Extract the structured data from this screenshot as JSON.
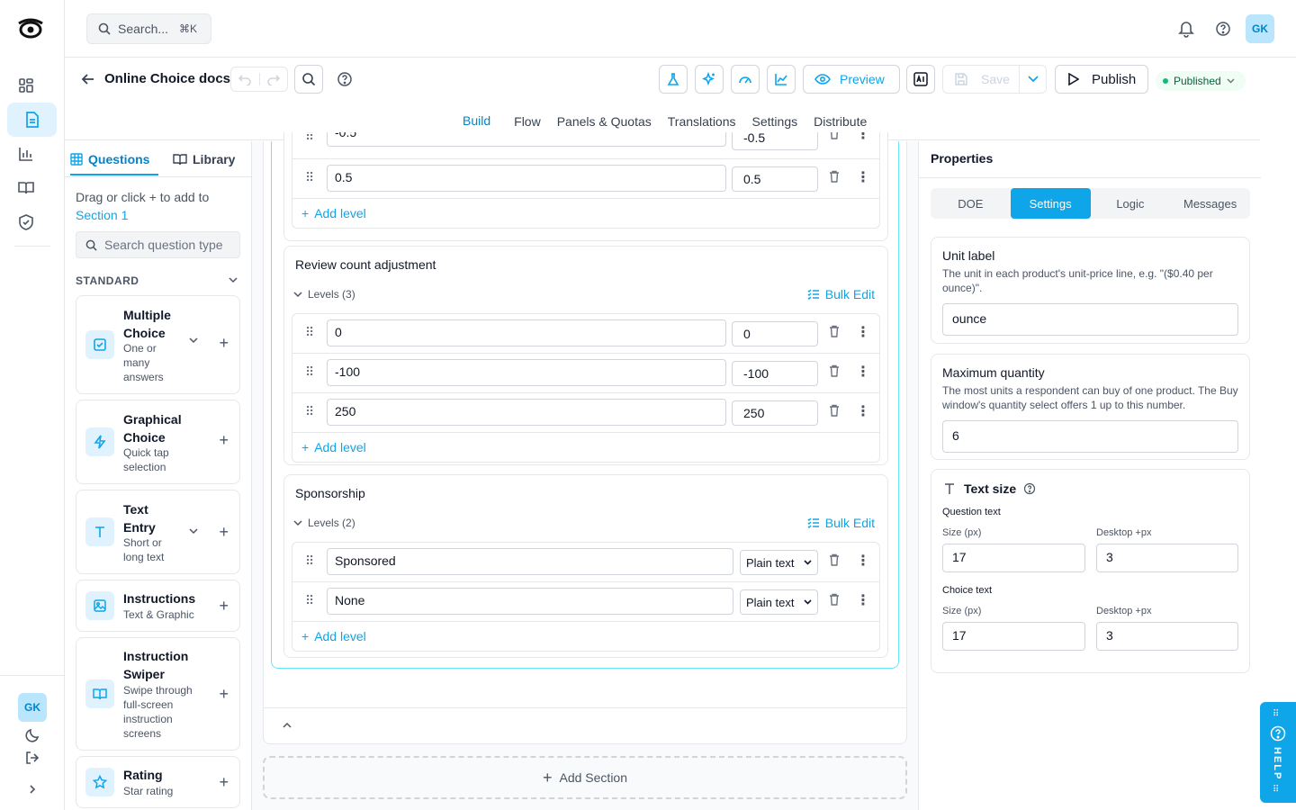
{
  "topbar": {
    "search_placeholder": "Search...",
    "search_shortcut": "⌘K",
    "user_initials": "GK"
  },
  "document": {
    "title": "Online Choice docs",
    "preview_label": "Preview",
    "save_label": "Save",
    "publish_label": "Publish",
    "status_label": "Published"
  },
  "tabs": [
    "Build",
    "Flow",
    "Panels & Quotas",
    "Translations",
    "Settings",
    "Distribute"
  ],
  "left_panel": {
    "tab_questions": "Questions",
    "tab_library": "Library",
    "hint_prefix": "Drag or click",
    "hint_suffix": "to add to",
    "hint_section": "Section 1",
    "search_placeholder": "Search question type",
    "category": "STANDARD",
    "items": [
      {
        "title": "Multiple Choice",
        "subtitle": "One or many answers"
      },
      {
        "title": "Graphical Choice",
        "subtitle": "Quick tap selection"
      },
      {
        "title": "Text Entry",
        "subtitle": "Short or long text"
      },
      {
        "title": "Instructions",
        "subtitle": "Text & Graphic"
      },
      {
        "title": "Instruction Swiper",
        "subtitle": "Swipe through full-screen instruction screens"
      },
      {
        "title": "Rating",
        "subtitle": "Star rating"
      }
    ]
  },
  "editor": {
    "partial_row": {
      "label": "-0.5",
      "value": "-0.5"
    },
    "top_row": {
      "label": "0.5",
      "value": "0.5"
    },
    "add_level": "Add level",
    "bulk_edit": "Bulk Edit",
    "attributes": [
      {
        "name": "Review count adjustment",
        "levels_label": "Levels (3)",
        "levels": [
          {
            "label": "0",
            "value": "0"
          },
          {
            "label": "-100",
            "value": "-100"
          },
          {
            "label": "250",
            "value": "250"
          }
        ]
      },
      {
        "name": "Sponsorship",
        "levels_label": "Levels (2)",
        "levels": [
          {
            "label": "Sponsored",
            "value": "Plain text"
          },
          {
            "label": "None",
            "value": "Plain text"
          }
        ]
      }
    ],
    "add_section": "Add Section"
  },
  "properties": {
    "title": "Properties",
    "tabs": [
      "DOE",
      "Settings",
      "Logic",
      "Messages"
    ],
    "active_tab": "Settings",
    "unit_label": {
      "title": "Unit label",
      "desc": "The unit in each product's unit-price line, e.g. \"($0.40 per ounce)\".",
      "value": "ounce"
    },
    "max_quantity": {
      "title": "Maximum quantity",
      "desc": "The most units a respondent can buy of one product. The Buy window's quantity select offers 1 up to this number.",
      "value": "6"
    },
    "text_size": {
      "title": "Text size",
      "question_text": "Question text",
      "choice_text": "Choice text",
      "size_label": "Size (px)",
      "desktop_label": "Desktop +px",
      "question_size": "17",
      "question_desktop": "3",
      "choice_size": "17",
      "choice_desktop": "3"
    }
  },
  "help_label": "HELP",
  "colors": {
    "accent": "#0ea5e9",
    "accent_light": "#e0f2fe",
    "published": "#10b981"
  }
}
